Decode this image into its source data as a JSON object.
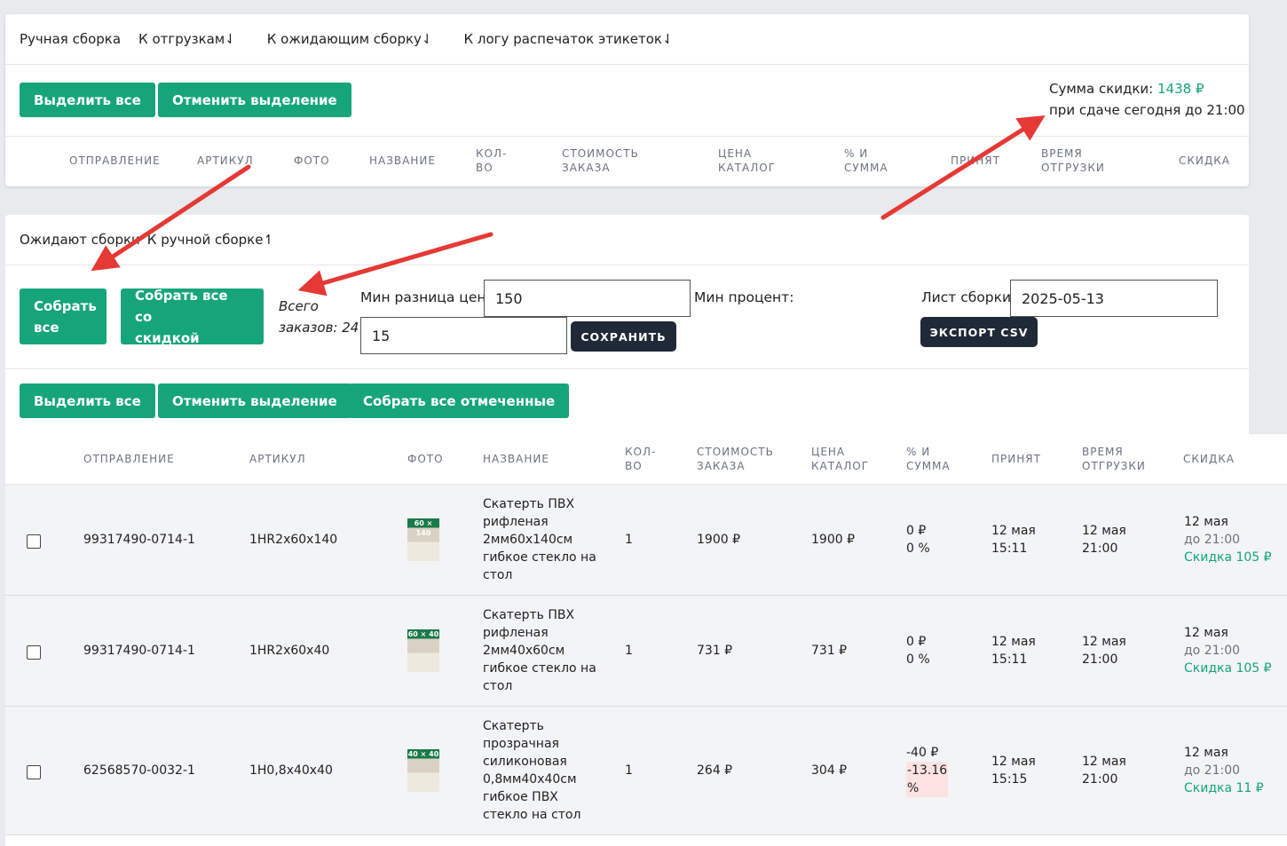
{
  "top_card": {
    "tabs": [
      "Ручная сборка",
      "К отгрузкам⇃",
      "К ожидающим сборку⇃",
      "К логу распечаток этикеток⇃"
    ],
    "select_all": "Выделить все",
    "deselect": "Отменить выделение",
    "discount_label": "Сумма скидки:",
    "discount_value": "1438 ₽",
    "discount_note": "при сдаче сегодня до 21:00",
    "headers": [
      "ОТПРАВЛЕНИЕ",
      "АРТИКУЛ",
      "ФОТО",
      "НАЗВАНИЕ",
      "КОЛ-",
      "ВО",
      "СТОИМОСТЬ",
      "ЗАКАЗА",
      "ЦЕНА",
      "КАТАЛОГ",
      "% И",
      "СУММА",
      "ПРИНЯТ",
      "ВРЕМЯ",
      "ОТГРУЗКИ",
      "СКИДКА"
    ]
  },
  "waiting_card": {
    "tabs": [
      "Ожидают сборки",
      "К ручной сборке↿"
    ],
    "collect_all_1": "Собрать",
    "collect_all_2": "все",
    "collect_discount_1": "Собрать все со",
    "collect_discount_2": "скидкой",
    "total_1": "Всего",
    "total_2": "заказов: 24",
    "min_diff_label": "Мин разница цен:",
    "min_diff_value": "150",
    "min_percent_label": "Мин процент:",
    "min_percent_value": "15",
    "save": "СОХРАНИТЬ",
    "sheet_label": "Лист сборки:",
    "sheet_date": "2025-05-13",
    "export": "ЭКСПОРТ CSV",
    "select_all": "Выделить все",
    "deselect": "Отменить выделение",
    "collect_checked": "Собрать все отмеченные"
  },
  "table": {
    "headers": {
      "shipment": "ОТПРАВЛЕНИЕ",
      "article": "АРТИКУЛ",
      "photo": "ФОТО",
      "name": "НАЗВАНИЕ",
      "qty_1": "КОЛ-",
      "qty_2": "ВО",
      "cost_1": "СТОИМОСТЬ",
      "cost_2": "ЗАКАЗА",
      "price_1": "ЦЕНА",
      "price_2": "КАТАЛОГ",
      "pct_1": "% И",
      "pct_2": "СУММА",
      "accepted": "ПРИНЯТ",
      "ship_1": "ВРЕМЯ",
      "ship_2": "ОТГРУЗКИ",
      "discount": "СКИДКА"
    },
    "rows": [
      {
        "shipment": "99317490-0714-1",
        "article": "1HR2x60x140",
        "thumb": "60 × 140",
        "name": [
          "Скатерть ПВХ",
          "рифленая",
          "2мм60x140см",
          "гибкое стекло на",
          "стол"
        ],
        "qty": "1",
        "cost": "1900 ₽",
        "price": "1900 ₽",
        "diff": "0 ₽",
        "pct": "0 %",
        "acc_date": "12 мая",
        "acc_time": "15:11",
        "ship_date": "12 мая",
        "ship_time": "21:00",
        "disc_date": "12 мая",
        "disc_until": "до 21:00",
        "disc_value": "Скидка 105 ₽"
      },
      {
        "shipment": "99317490-0714-1",
        "article": "1HR2x60x40",
        "thumb": "60 × 40",
        "name": [
          "Скатерть ПВХ",
          "рифленая",
          "2мм40x60см",
          "гибкое стекло на",
          "стол"
        ],
        "qty": "1",
        "cost": "731 ₽",
        "price": "731 ₽",
        "diff": "0 ₽",
        "pct": "0 %",
        "acc_date": "12 мая",
        "acc_time": "15:11",
        "ship_date": "12 мая",
        "ship_time": "21:00",
        "disc_date": "12 мая",
        "disc_until": "до 21:00",
        "disc_value": "Скидка 105 ₽"
      },
      {
        "shipment": "62568570-0032-1",
        "article": "1H0,8x40x40",
        "thumb": "40 × 40",
        "name": [
          "Скатерть",
          "прозрачная",
          "силиконовая",
          "0,8мм40x40см",
          "гибкое ПВХ",
          "стекло на стол"
        ],
        "qty": "1",
        "cost": "264 ₽",
        "price": "304 ₽",
        "diff": "-40 ₽",
        "pct_a": "-13.16",
        "pct_b": "%",
        "acc_date": "12 мая",
        "acc_time": "15:15",
        "ship_date": "12 мая",
        "ship_time": "21:00",
        "disc_date": "12 мая",
        "disc_until": "до 21:00",
        "disc_value": "Скидка 11 ₽"
      }
    ]
  },
  "colors": {
    "accent_green": "#16a57a",
    "dark_button": "#1f2937",
    "annotation_red": "#e53935",
    "negative_bg": "#fde2e2"
  }
}
